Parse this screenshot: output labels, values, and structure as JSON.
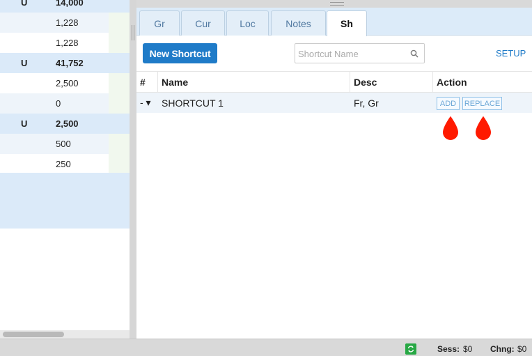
{
  "left_panel": {
    "rows": [
      {
        "type": "grp",
        "c1": "U",
        "c2": "14,000"
      },
      {
        "type": "alt",
        "c1": "",
        "c2": "1,228"
      },
      {
        "type": "plain",
        "c1": "",
        "c2": "1,228"
      },
      {
        "type": "grp",
        "c1": "U",
        "c2": "41,752"
      },
      {
        "type": "plain",
        "c1": "",
        "c2": "2,500"
      },
      {
        "type": "alt",
        "c1": "",
        "c2": "0"
      },
      {
        "type": "grp",
        "c1": "U",
        "c2": "2,500"
      },
      {
        "type": "alt",
        "c1": "",
        "c2": "500"
      },
      {
        "type": "plain",
        "c1": "",
        "c2": "250"
      }
    ]
  },
  "tabs": [
    {
      "label": "Gr",
      "active": false
    },
    {
      "label": "Cur",
      "active": false
    },
    {
      "label": "Loc",
      "active": false
    },
    {
      "label": "Notes",
      "active": false
    },
    {
      "label": "Sh",
      "active": true
    }
  ],
  "toolbar": {
    "new_shortcut_label": "New Shortcut",
    "search_placeholder": "Shortcut Name",
    "setup_label": "SETUP"
  },
  "table": {
    "headers": {
      "num": "#",
      "name": "Name",
      "desc": "Desc",
      "action": "Action"
    },
    "rows": [
      {
        "num": "- ▾",
        "name": "SHORTCUT 1",
        "desc": "Fr, Gr",
        "add_label": "ADD",
        "replace_label": "REPLACE"
      }
    ]
  },
  "colors": {
    "accent": "#1f7bc8",
    "drop": "#ff1a00",
    "sync": "#27a844"
  },
  "status_bar": {
    "sess_label": "Sess:",
    "sess_value": "$0",
    "chng_label": "Chng:",
    "chng_value": "$0"
  }
}
